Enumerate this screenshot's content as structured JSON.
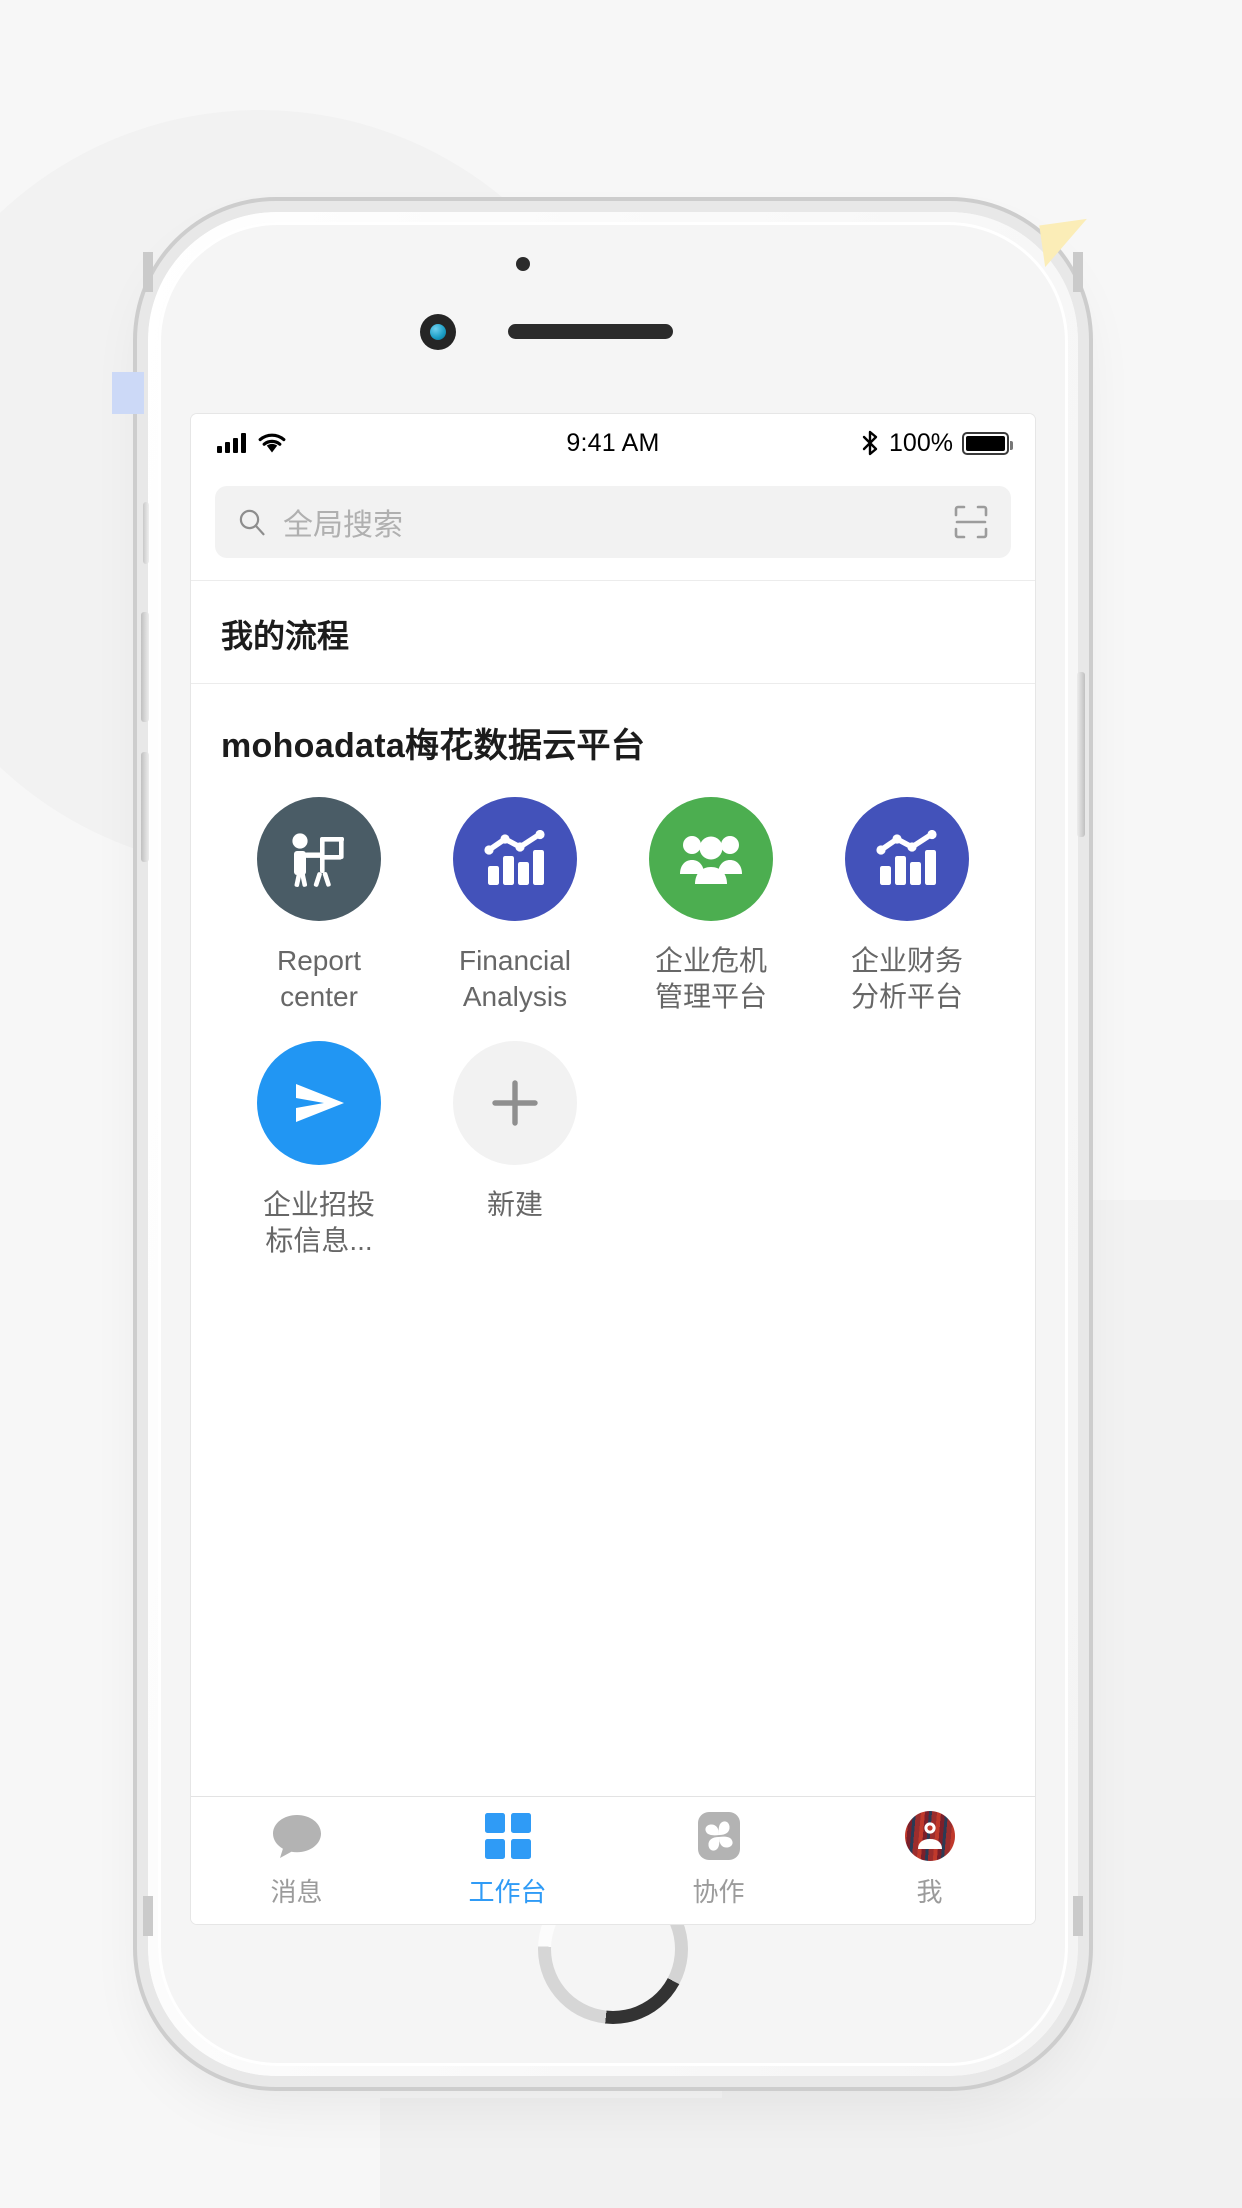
{
  "status_bar": {
    "time": "9:41 AM",
    "battery_percent": "100%",
    "signal_icon": "cellular-signal-icon",
    "wifi_icon": "wifi-icon",
    "bluetooth_icon": "bluetooth-icon",
    "battery_icon": "battery-full-icon"
  },
  "search": {
    "placeholder": "全局搜索",
    "search_icon": "search-icon",
    "scan_icon": "qr-scan-icon"
  },
  "section": {
    "title": "我的流程"
  },
  "group": {
    "name": "mohoadata梅花数据云平台",
    "apps": [
      {
        "label": "Report center",
        "icon": "presentation-person-icon",
        "color": "#4a5c66"
      },
      {
        "label": "Financial Analysis",
        "icon": "bar-chart-trend-icon",
        "color": "#4352ba"
      },
      {
        "label": "企业危机管理平台",
        "icon": "group-people-icon",
        "color": "#4cae50"
      },
      {
        "label": "企业财务分析平台",
        "icon": "bar-chart-trend-icon",
        "color": "#4352ba"
      },
      {
        "label": "企业招投标信息...",
        "icon": "paper-plane-icon",
        "color": "#2196f3"
      },
      {
        "label": "新建",
        "icon": "plus-icon",
        "color": "#f2f2f2"
      }
    ]
  },
  "tabbar": {
    "items": [
      {
        "label": "消息",
        "icon": "chat-bubble-icon",
        "active": false
      },
      {
        "label": "工作台",
        "icon": "grid-squares-icon",
        "active": true
      },
      {
        "label": "协作",
        "icon": "collaboration-icon",
        "active": false
      },
      {
        "label": "我",
        "icon": "avatar-icon",
        "active": false
      }
    ],
    "active_color": "#2f9bf6",
    "inactive_color": "#9b9b9b"
  }
}
